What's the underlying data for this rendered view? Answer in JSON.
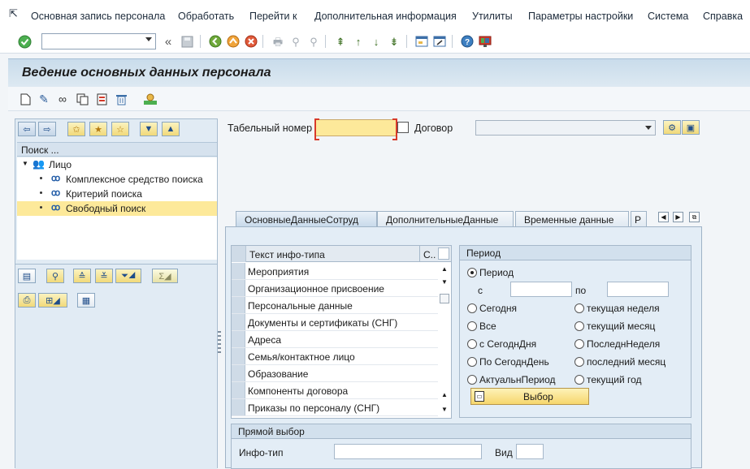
{
  "menu": {
    "items": [
      "Основная запись персонала",
      "Обработать",
      "Перейти к",
      "Дополнительная информация",
      "Утилиты",
      "Параметры настройки",
      "Система",
      "Справка"
    ]
  },
  "page": {
    "title": "Ведение основных данных персонала"
  },
  "tree": {
    "header": "Поиск ...",
    "root": "Лицо",
    "items": [
      "Комплексное средство поиска",
      "Критерий поиска",
      "Свободный поиск"
    ]
  },
  "header_fields": {
    "personnel_number_label": "Табельный номер",
    "personnel_number_value": "",
    "contract_label": "Договор",
    "contract_value": ""
  },
  "tabs": [
    "ОсновныеДанныеСотруд",
    "ДополнительныеДанные",
    "Временные данные",
    "Р"
  ],
  "infotype_list": {
    "col_text": "Текст инфо-типа",
    "col_short": "С..",
    "rows": [
      "Мероприятия",
      "Организационное присвоение",
      "Персональные данные",
      "Документы и сертификаты (СНГ)",
      "Адреса",
      "Семья/контактное лицо",
      "Образование",
      "Компоненты договора",
      "Приказы по персоналу (СНГ)"
    ]
  },
  "period": {
    "title": "Период",
    "option_period": "Период",
    "from_label": "с",
    "to_label": "по",
    "from_value": "",
    "to_value": "",
    "left_options": [
      "Сегодня",
      "Все",
      "с СегоднДня",
      "По СегоднДень",
      "АктуальнПериод"
    ],
    "right_options": [
      "текущая неделя",
      "текущий месяц",
      "ПоследнНеделя",
      "последний месяц",
      "текущий год"
    ],
    "select_button": "Выбор"
  },
  "direct": {
    "title": "Прямой выбор",
    "infotype_label": "Инфо-тип",
    "infotype_value": "",
    "view_label": "Вид",
    "view_value": ""
  }
}
